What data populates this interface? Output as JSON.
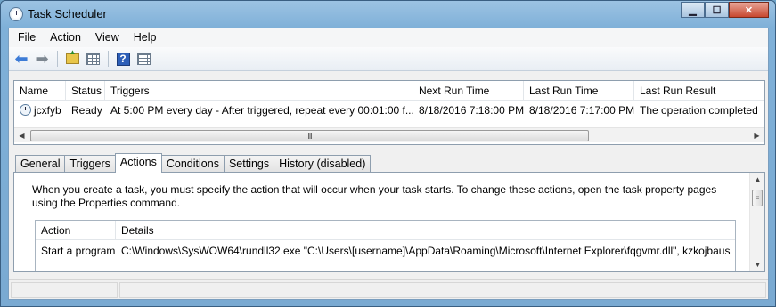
{
  "window": {
    "title": "Task Scheduler"
  },
  "window_buttons": {
    "minimize": "▁",
    "maximize": "☐",
    "close": "✕"
  },
  "menu": [
    "File",
    "Action",
    "View",
    "Help"
  ],
  "toolbar": {
    "buttons": [
      "back-arrow-icon",
      "forward-arrow-icon",
      "up-folder-icon",
      "show-hide-console-tree-icon",
      "help-icon",
      "show-hide-action-pane-icon"
    ]
  },
  "task_list": {
    "columns": [
      "Name",
      "Status",
      "Triggers",
      "Next Run Time",
      "Last Run Time",
      "Last Run Result"
    ],
    "rows": [
      {
        "name": "jcxfyb",
        "status": "Ready",
        "triggers": "At 5:00 PM every day - After triggered, repeat every 00:01:00 f...",
        "next_run": "8/18/2016 7:18:00 PM",
        "last_run": "8/18/2016 7:17:00 PM",
        "last_result": "The operation completed"
      }
    ],
    "scroll_grip": "III",
    "scroll_left": "◀",
    "scroll_right": "▶"
  },
  "tabs": [
    "General",
    "Triggers",
    "Actions",
    "Conditions",
    "Settings",
    "History (disabled)"
  ],
  "active_tab": "Actions",
  "actions_panel": {
    "description": "When you create a task, you must specify the action that will occur when your task starts.  To change these actions, open the task property pages using the Properties command.",
    "columns": [
      "Action",
      "Details"
    ],
    "rows": [
      {
        "action": "Start a program",
        "details": "C:\\Windows\\SysWOW64\\rundll32.exe \"C:\\Users\\[username]\\AppData\\Roaming\\Microsoft\\Internet Explorer\\fqgvmr.dll\", kzkojbaus"
      }
    ],
    "scroll_up": "▲",
    "scroll_down": "▼",
    "scroll_grip": "≡"
  }
}
